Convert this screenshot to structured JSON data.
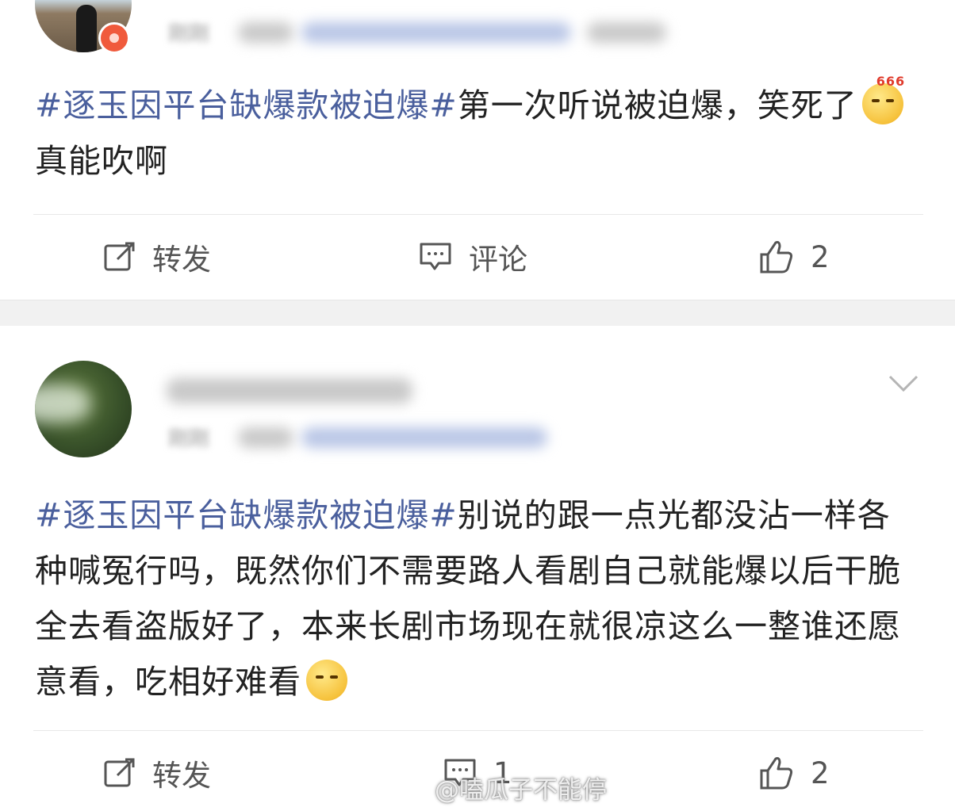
{
  "posts": [
    {
      "time_partial": "刚刚",
      "content": {
        "hashtag": "#逐玉因平台缺爆款被迫爆#",
        "text_before_emoji": "第一次听说被迫爆，笑死了",
        "emoji_label": "666",
        "text_after_emoji": "真能吹啊"
      },
      "actions": {
        "repost_label": "转发",
        "comment_label": "评论",
        "like_count": "2"
      }
    },
    {
      "time_partial": "刚刚",
      "content": {
        "hashtag": "#逐玉因平台缺爆款被迫爆#",
        "text": "别说的跟一点光都没沾一样各种喊冤行吗，既然你们不需要路人看剧自己就能爆以后干脆全去看盗版好了，本来长剧市场现在就很凉这么一整谁还愿意看，吃相好难看"
      },
      "actions": {
        "repost_label": "转发",
        "comment_count": "1",
        "like_count": "2"
      }
    }
  ],
  "watermark": "@嗑瓜子不能停",
  "icons": [
    "repost-icon",
    "comment-icon",
    "like-icon",
    "chevron-down-icon",
    "weibo-logo-icon"
  ],
  "colors": {
    "hashtag": "#4a5f9d",
    "text": "#222222",
    "action": "#555555",
    "separator": "#f1f1f1"
  }
}
